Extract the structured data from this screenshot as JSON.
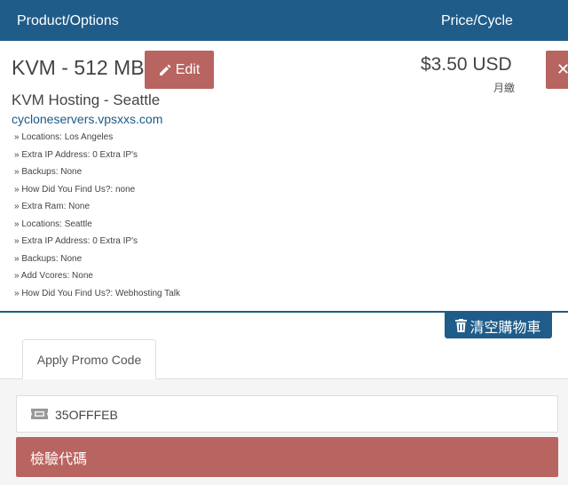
{
  "header": {
    "product_column": "Product/Options",
    "price_column": "Price/Cycle"
  },
  "item": {
    "name": "KVM - 512 MB",
    "edit_label": "Edit",
    "group": "KVM Hosting - Seattle",
    "domain": "cycloneservers.vpsxxs.com",
    "price": "$3.50 USD",
    "cycle": "月繳",
    "remove_label": "✕",
    "options": [
      "» Locations: Los Angeles",
      "» Extra IP Address: 0 Extra IP's",
      "» Backups: None",
      "» How Did You Find Us?: none",
      "» Extra Ram: None",
      "» Locations: Seattle",
      "» Extra IP Address: 0 Extra IP's",
      "» Backups: None",
      "» Add Vcores: None",
      "» How Did You Find Us?: Webhosting Talk"
    ]
  },
  "cart": {
    "empty_cart_label": "清空購物車"
  },
  "promo": {
    "tab_label": "Apply Promo Code",
    "code_value": "35OFFFEB",
    "validate_label": "檢驗代碼"
  },
  "colors": {
    "brand_blue": "#1f5c8a",
    "danger_red": "#b86460"
  }
}
